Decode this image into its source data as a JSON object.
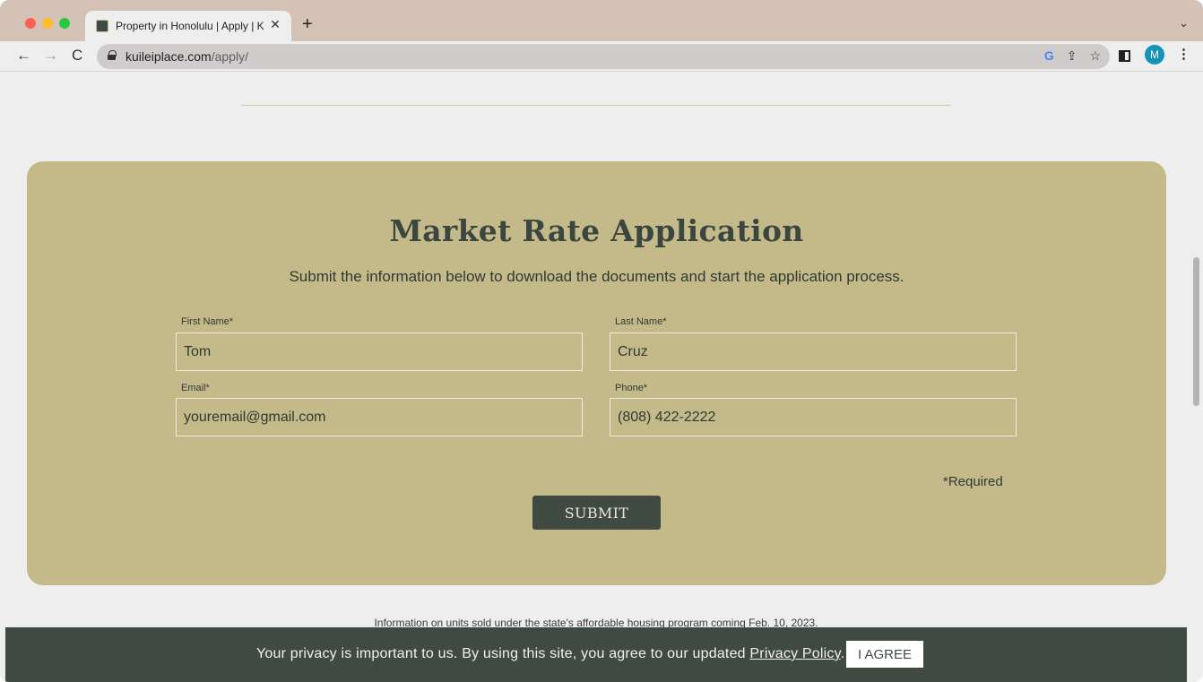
{
  "browser": {
    "tab_title": "Property in Honolulu | Apply | K",
    "tab_close": "✕",
    "new_tab": "+",
    "tab_menu": "⌄",
    "url_domain": "kuileiplace.com",
    "url_path": "/apply/",
    "back": "←",
    "forward": "→",
    "reload": "C",
    "profile_initial": "M",
    "google_icon": "G",
    "share_icon": "⇪",
    "bookmark_icon": "☆",
    "menu_icon": "⋮"
  },
  "form": {
    "title": "Market Rate Application",
    "subtitle": "Submit the information below to download the documents and start the application process.",
    "first_name_label": "First Name*",
    "first_name_value": "Tom",
    "last_name_label": "Last Name*",
    "last_name_value": "Cruz",
    "email_label": "Email*",
    "email_placeholder": "youremail@gmail.com",
    "phone_label": "Phone*",
    "phone_value": "(808) 422-2222",
    "required_note": "*Required",
    "submit_label": "SUBMIT"
  },
  "footnote": "Information on units sold under the state's affordable housing program coming Feb. 10, 2023.",
  "cookie": {
    "text_before": "Your privacy is important to us. By using this site, you agree to our updated ",
    "link": "Privacy Policy",
    "text_after": ".",
    "agree_label": "I AGREE"
  }
}
